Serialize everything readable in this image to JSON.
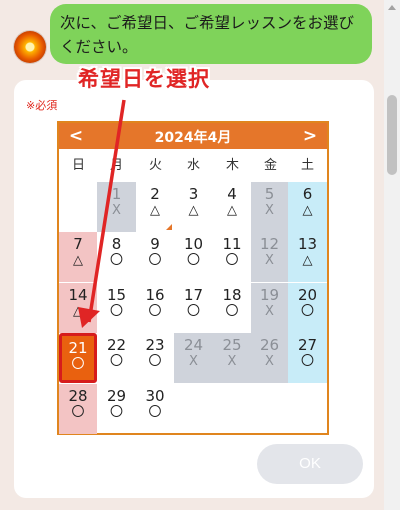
{
  "chat": {
    "bot_message": "次に、ご希望日、ご希望レッスンをお選びください。"
  },
  "form": {
    "required_label": "※必須",
    "ok_label": "OK"
  },
  "annotation": {
    "text": "希望日を選択",
    "color": "#e02525"
  },
  "calendar": {
    "title": "2024年4月",
    "prev_label": "<",
    "next_label": ">",
    "weekdays": [
      "日",
      "月",
      "火",
      "水",
      "木",
      "金",
      "土"
    ],
    "selected_date": "21",
    "days": [
      {
        "day": "1",
        "mark": "X",
        "status": "past"
      },
      {
        "day": "2",
        "mark": "△",
        "status": "open"
      },
      {
        "day": "3",
        "mark": "△",
        "status": "open"
      },
      {
        "day": "4",
        "mark": "△",
        "status": "open"
      },
      {
        "day": "5",
        "mark": "X",
        "status": "past"
      },
      {
        "day": "6",
        "mark": "△",
        "status": "sat"
      },
      {
        "day": "7",
        "mark": "△",
        "status": "sun"
      },
      {
        "day": "8",
        "mark": "〇",
        "status": "open"
      },
      {
        "day": "9",
        "mark": "〇",
        "status": "open"
      },
      {
        "day": "10",
        "mark": "〇",
        "status": "open"
      },
      {
        "day": "11",
        "mark": "〇",
        "status": "open"
      },
      {
        "day": "12",
        "mark": "X",
        "status": "past"
      },
      {
        "day": "13",
        "mark": "△",
        "status": "sat"
      },
      {
        "day": "14",
        "mark": "△",
        "status": "sun"
      },
      {
        "day": "15",
        "mark": "〇",
        "status": "open"
      },
      {
        "day": "16",
        "mark": "〇",
        "status": "open"
      },
      {
        "day": "17",
        "mark": "〇",
        "status": "open"
      },
      {
        "day": "18",
        "mark": "〇",
        "status": "open"
      },
      {
        "day": "19",
        "mark": "X",
        "status": "past"
      },
      {
        "day": "20",
        "mark": "〇",
        "status": "sat"
      },
      {
        "day": "21",
        "mark": "〇",
        "status": "selected"
      },
      {
        "day": "22",
        "mark": "〇",
        "status": "open"
      },
      {
        "day": "23",
        "mark": "〇",
        "status": "open"
      },
      {
        "day": "24",
        "mark": "X",
        "status": "past"
      },
      {
        "day": "25",
        "mark": "X",
        "status": "past"
      },
      {
        "day": "26",
        "mark": "X",
        "status": "past"
      },
      {
        "day": "27",
        "mark": "〇",
        "status": "sat"
      },
      {
        "day": "28",
        "mark": "〇",
        "status": "sun"
      },
      {
        "day": "29",
        "mark": "〇",
        "status": "open"
      },
      {
        "day": "30",
        "mark": "〇",
        "status": "open"
      }
    ],
    "colors": {
      "header": "#e5762a",
      "past": "#cfd3db",
      "saturday": "#c8ecf8",
      "sunday": "#f3c4c4",
      "selected": "#e9610f"
    }
  }
}
